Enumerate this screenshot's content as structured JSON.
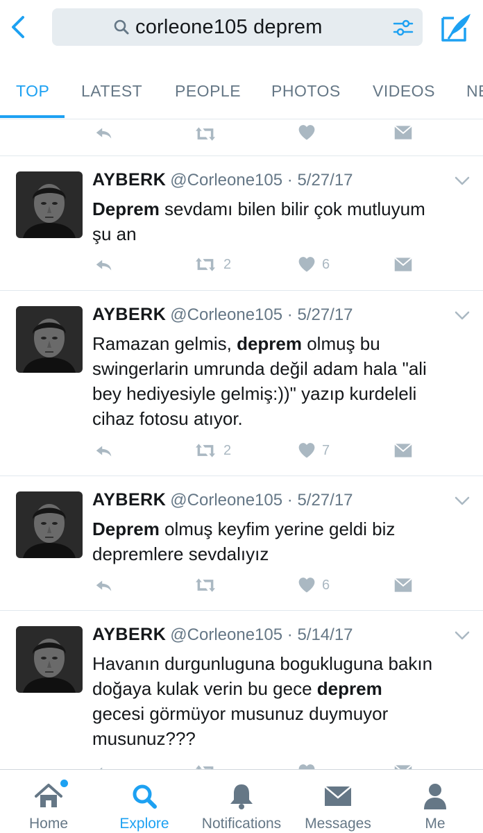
{
  "search": {
    "query": "corleone105 deprem"
  },
  "tabs": [
    {
      "label": "TOP"
    },
    {
      "label": "LATEST"
    },
    {
      "label": "PEOPLE"
    },
    {
      "label": "PHOTOS"
    },
    {
      "label": "VIDEOS"
    },
    {
      "label": "NE"
    }
  ],
  "tweets": [
    {
      "name": "AYBERK",
      "handle": "@Corleone105",
      "date": "5/27/17",
      "retweets": "2",
      "likes": "6"
    },
    {
      "name": "AYBERK",
      "handle": "@Corleone105",
      "date": "5/27/17",
      "retweets": "2",
      "likes": "7"
    },
    {
      "name": "AYBERK",
      "handle": "@Corleone105",
      "date": "5/27/17",
      "retweets": "",
      "likes": "6"
    },
    {
      "name": "AYBERK",
      "handle": "@Corleone105",
      "date": "5/14/17",
      "retweets": "",
      "likes": ""
    }
  ],
  "tweet_texts": {
    "t0": {
      "kw": "Deprem",
      "rest": " sevdamı bilen bilir çok mutluyum şu an"
    },
    "t1": {
      "pre": "Ramazan gelmis, ",
      "kw": "deprem",
      "rest": " olmuş bu swingerlarin umrunda değil adam hala \"ali bey hediyesiyle gelmiş:))\" yazıp kurdeleli cihaz fotosu atıyor."
    },
    "t2": {
      "kw": "Deprem",
      "rest": " olmuş keyfim yerine geldi biz depremlere sevdalıyız"
    },
    "t3": {
      "pre": "Havanın durgunluguna bogukluguna bakın doğaya kulak verin bu gece ",
      "kw": "deprem",
      "rest": " gecesi görmüyor musunuz duymuyor musunuz???"
    }
  },
  "separator": "·",
  "nav": [
    {
      "label": "Home"
    },
    {
      "label": "Explore"
    },
    {
      "label": "Notifications"
    },
    {
      "label": "Messages"
    },
    {
      "label": "Me"
    }
  ],
  "colors": {
    "accent": "#1da1f2",
    "muted": "#657786",
    "icon_gray": "#aab8c2"
  }
}
